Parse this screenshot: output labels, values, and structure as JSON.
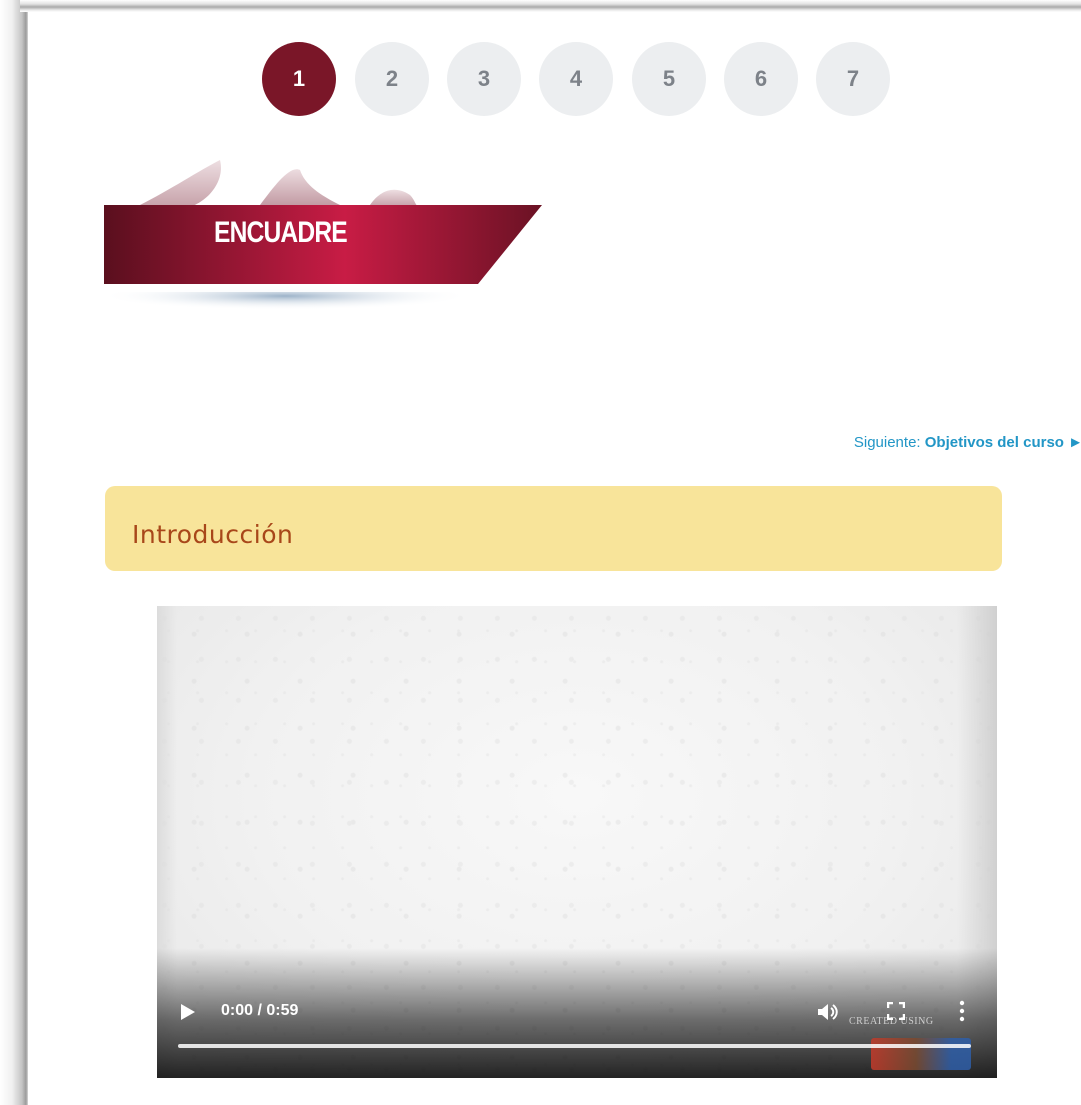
{
  "pagination": {
    "pages": [
      "1",
      "2",
      "3",
      "4",
      "5",
      "6",
      "7"
    ],
    "active": "1"
  },
  "banner": {
    "title": "ENCUADRE"
  },
  "navigation": {
    "next_prefix": "Siguiente:",
    "next_title": "Objetivos del curso",
    "next_arrow": "►"
  },
  "section": {
    "title": "Introducción"
  },
  "video": {
    "time": "0:00 / 0:59",
    "watermark_text": "CREATED USING",
    "progress_fraction": 0
  },
  "colors": {
    "active_page": "#7a1628",
    "inactive_page": "#eceef0",
    "link": "#2296c6",
    "intro_background": "#f8e49a",
    "intro_text": "#a8471a"
  },
  "icons": [
    "play-icon",
    "volume-icon",
    "fullscreen-icon",
    "more-options-icon"
  ]
}
